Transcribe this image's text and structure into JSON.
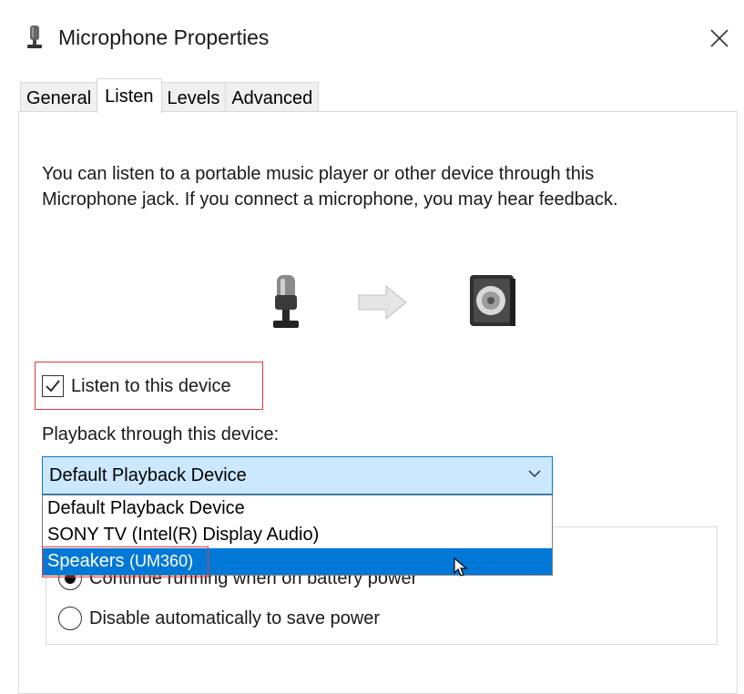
{
  "window": {
    "title": "Microphone Properties"
  },
  "tabs": [
    {
      "label": "General"
    },
    {
      "label": "Listen"
    },
    {
      "label": "Levels"
    },
    {
      "label": "Advanced"
    }
  ],
  "active_tab": "Listen",
  "description": {
    "line1": "You can listen to a portable music player or other device through this",
    "line2": "Microphone jack.  If you connect a microphone, you may hear feedback."
  },
  "listen_checkbox": {
    "label": "Listen to this device",
    "checked": true
  },
  "playback": {
    "label": "Playback through this device:",
    "selected_value": "Default Playback Device",
    "options": [
      {
        "name": "Default Playback Device",
        "paren": ""
      },
      {
        "name": "SONY TV (Intel(R) Display Audio)",
        "paren": ""
      },
      {
        "name": "Speakers",
        "paren": "(UM360)"
      }
    ],
    "highlighted_index": 2
  },
  "power": {
    "option_continue": "Continue running when on battery power",
    "option_disable": "Disable automatically to save power",
    "selected": "continue"
  },
  "colors": {
    "accent": "#0078d7",
    "combo_bg": "#cce8ff",
    "annotation_red": "#e03a3a"
  },
  "icons": {
    "title": "microphone-icon",
    "close": "close-icon",
    "source": "microphone-icon",
    "arrow": "arrow-right-icon",
    "target": "speaker-icon",
    "chevron": "chevron-down-icon",
    "check": "checkmark-icon",
    "cursor": "mouse-pointer-icon"
  }
}
